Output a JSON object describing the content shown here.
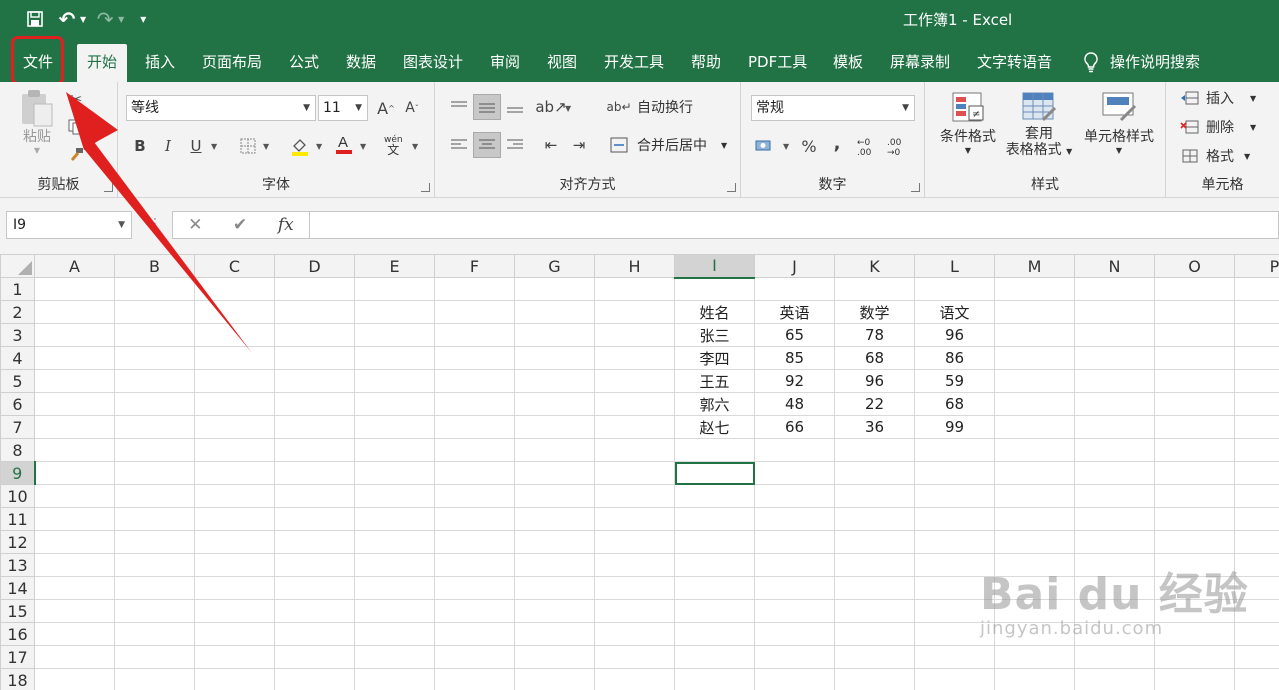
{
  "window": {
    "title": "工作簿1  -  Excel"
  },
  "qat": {
    "save": "💾",
    "undo": "↶",
    "redo": "↷",
    "customize": "▾"
  },
  "tabs": [
    {
      "label": "文件"
    },
    {
      "label": "开始"
    },
    {
      "label": "插入"
    },
    {
      "label": "页面布局"
    },
    {
      "label": "公式"
    },
    {
      "label": "数据"
    },
    {
      "label": "图表设计"
    },
    {
      "label": "审阅"
    },
    {
      "label": "视图"
    },
    {
      "label": "开发工具"
    },
    {
      "label": "帮助"
    },
    {
      "label": "PDF工具"
    },
    {
      "label": "模板"
    },
    {
      "label": "屏幕录制"
    },
    {
      "label": "文字转语音"
    }
  ],
  "tell_me": "操作说明搜索",
  "ribbon": {
    "clipboard": {
      "paste": "粘贴",
      "label": "剪贴板"
    },
    "font": {
      "name": "等线",
      "size": "11",
      "bold": "B",
      "italic": "I",
      "underline": "U",
      "phonetic_top": "wén",
      "phonetic_bottom": "文",
      "label": "字体"
    },
    "alignment": {
      "wrap": "自动换行",
      "merge": "合并后居中",
      "label": "对齐方式"
    },
    "number": {
      "format": "常规",
      "percent": "%",
      "comma": ",",
      "inc": "←0 .00",
      "dec": ".00 →0",
      "label": "数字"
    },
    "styles": {
      "conditional": "条件格式",
      "table_line1": "套用",
      "table_line2": "表格格式",
      "cell_styles": "单元格样式",
      "label": "样式"
    },
    "cells": {
      "insert": "插入",
      "delete": "删除",
      "format": "格式",
      "label": "单元格"
    }
  },
  "formula_bar": {
    "name_box": "I9",
    "cancel": "✕",
    "enter": "✔",
    "fx": "fx",
    "value": ""
  },
  "sheet": {
    "columns": [
      "A",
      "B",
      "C",
      "D",
      "E",
      "F",
      "G",
      "H",
      "I",
      "J",
      "K",
      "L",
      "M",
      "N",
      "O",
      "P"
    ],
    "rows": [
      "1",
      "2",
      "3",
      "4",
      "5",
      "6",
      "7",
      "8",
      "9",
      "10",
      "11",
      "12",
      "13",
      "14",
      "15",
      "16",
      "17",
      "18"
    ],
    "selected_col": "I",
    "selected_row": "9",
    "table": [
      [
        "姓名",
        "英语",
        "数学",
        "语文"
      ],
      [
        "张三",
        "65",
        "78",
        "96"
      ],
      [
        "李四",
        "85",
        "68",
        "86"
      ],
      [
        "王五",
        "92",
        "96",
        "59"
      ],
      [
        "郭六",
        "48",
        "22",
        "68"
      ],
      [
        "赵七",
        "66",
        "36",
        "99"
      ]
    ]
  },
  "watermark": {
    "brand": "Bai du 经验",
    "url": "jingyan.baidu.com"
  },
  "colors": {
    "accent": "#217346",
    "annotation": "#e02020"
  }
}
